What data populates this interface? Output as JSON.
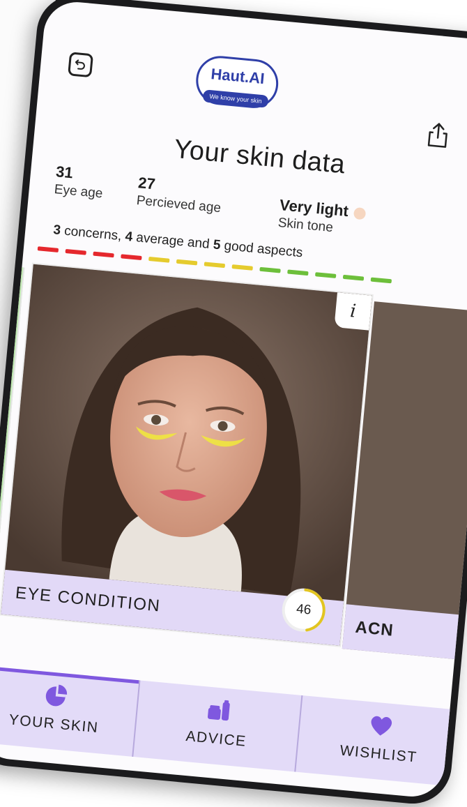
{
  "header": {
    "brand": "Haut.AI",
    "tagline": "We know your skin",
    "title": "Your skin data"
  },
  "stats": {
    "eye_age": {
      "value": "31",
      "label": "Eye age"
    },
    "perceived_age": {
      "value": "27",
      "label": "Percieved age"
    },
    "skin_tone": {
      "value": "Very light",
      "label": "Skin tone",
      "color": "#f6d6c0"
    }
  },
  "summary": {
    "concerns_count": "3",
    "concerns_text": " concerns, ",
    "average_count": "4",
    "average_text": " average and ",
    "good_count": "5",
    "good_text": " good aspects"
  },
  "aspect_bar": {
    "segments": [
      "red",
      "red",
      "red",
      "red",
      "yellow",
      "yellow",
      "yellow",
      "yellow",
      "green",
      "green",
      "green",
      "green",
      "green"
    ],
    "colors": {
      "red": "#e5282d",
      "yellow": "#e5cb2e",
      "green": "#6dbf3b"
    }
  },
  "card": {
    "name": "EYE CONDITION",
    "score": "46",
    "score_fraction": 0.46,
    "info_label": "i"
  },
  "next_card": {
    "name": "ACN"
  },
  "nav": {
    "items": [
      {
        "label": "YOUR SKIN",
        "icon": "pie-chart-icon",
        "active": true
      },
      {
        "label": "ADVICE",
        "icon": "products-icon",
        "active": false
      },
      {
        "label": "WISHLIST",
        "icon": "heart-icon",
        "active": false
      }
    ]
  },
  "colors": {
    "accent": "#7f58df",
    "nav_bg": "#e3dbf8",
    "brand": "#2f3fa8"
  }
}
